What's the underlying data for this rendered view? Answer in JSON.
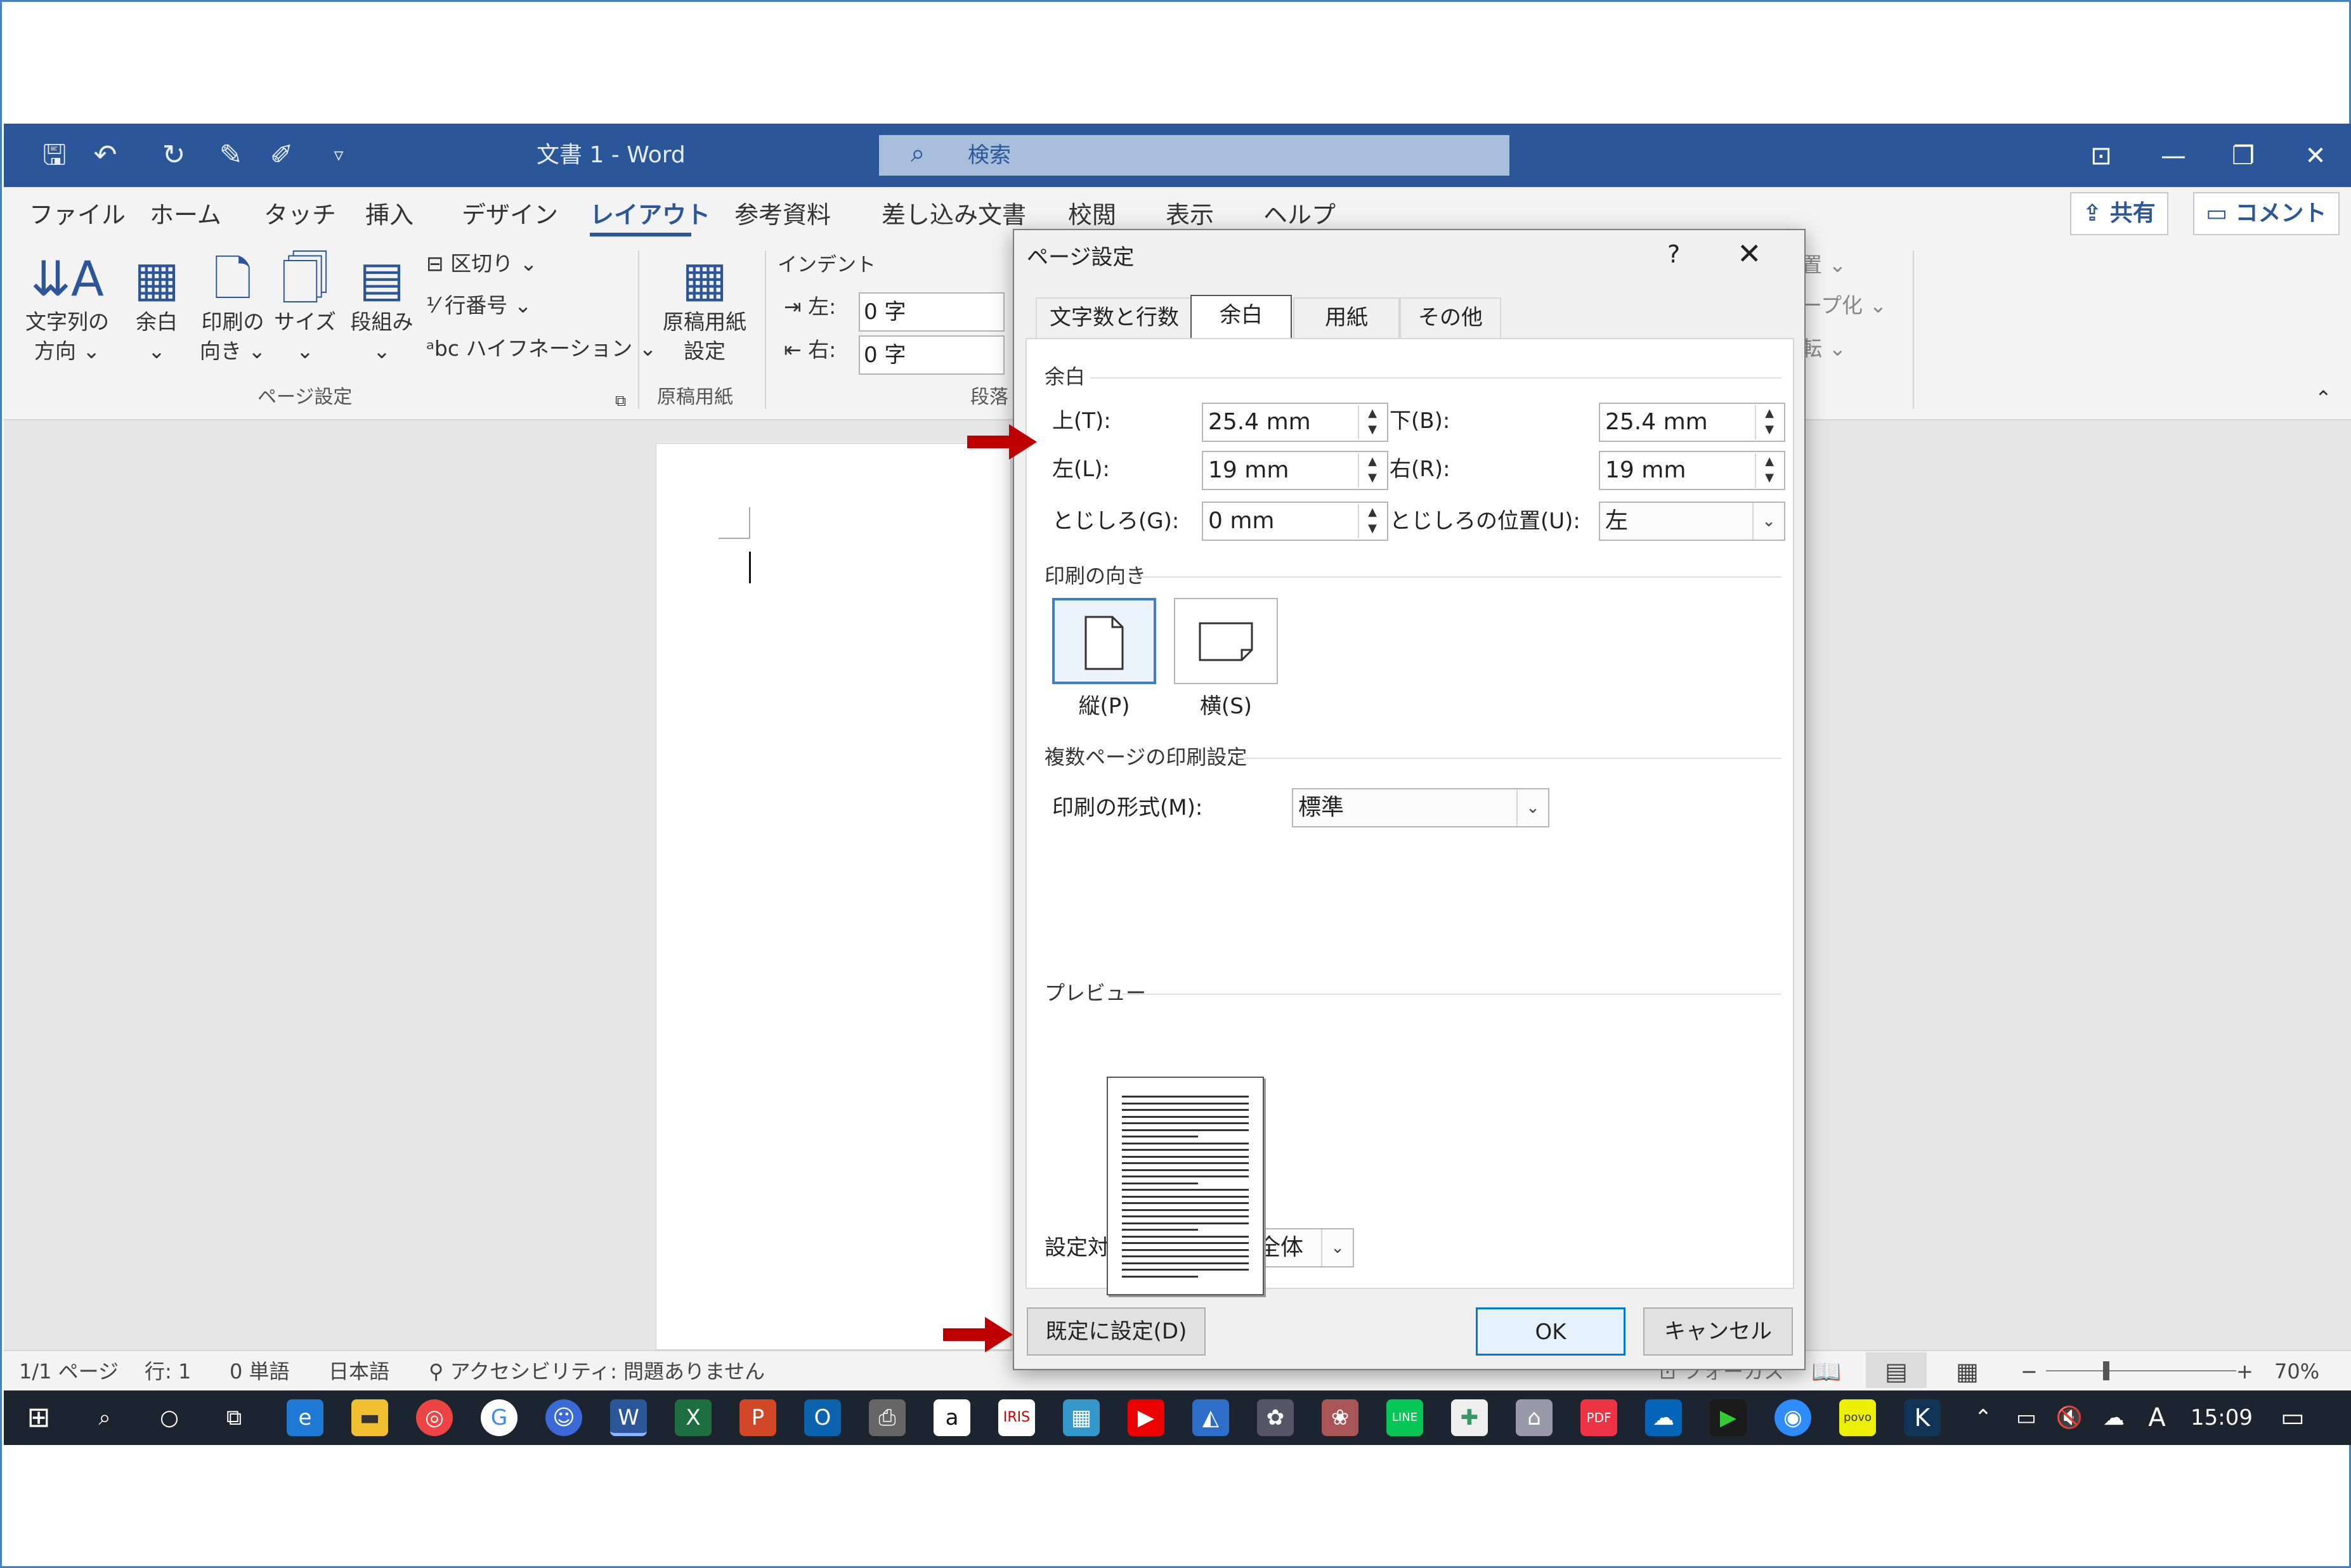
{
  "app": {
    "doc_title": "文書 1  -  Word",
    "search_placeholder": "検索"
  },
  "ribbon": {
    "tabs": [
      "ファイル",
      "ホーム",
      "タッチ",
      "挿入",
      "デザイン",
      "レイアウト",
      "参考資料",
      "差し込み文書",
      "校閲",
      "表示",
      "ヘルプ"
    ],
    "active_tab": "レイアウト",
    "share": "共有",
    "comment": "コメント",
    "buttons": {
      "text_direction": [
        "文字列の",
        "方向 ⌄"
      ],
      "margins": [
        "余白",
        "⌄"
      ],
      "orientation": [
        "印刷の",
        "向き ⌄"
      ],
      "size": [
        "サイズ",
        "⌄"
      ],
      "columns": [
        "段組み",
        "⌄"
      ],
      "breaks": "区切り ⌄",
      "line_numbers": "行番号 ⌄",
      "hyphenation": "ハイフネーション ⌄",
      "manuscript": [
        "原稿用紙",
        "設定"
      ],
      "indent_title": "インデント",
      "indent_left_label": "左:",
      "indent_left_value": "0 字",
      "indent_right_label": "右:",
      "indent_right_value": "0 字",
      "partial_1": "置 ⌄",
      "partial_2": "ープ化 ⌄",
      "partial_3": "転 ⌄"
    },
    "groups": {
      "page_setup": "ページ設定",
      "manuscript": "原稿用紙",
      "paragraph": "段落"
    }
  },
  "dialog": {
    "title": "ページ設定",
    "help": "?",
    "close": "✕",
    "tabs": [
      "文字数と行数",
      "余白",
      "用紙",
      "その他"
    ],
    "active_tab": "余白",
    "margins_section": "余白",
    "top_label": "上(T):",
    "top_value": "25.4 mm",
    "bottom_label": "下(B):",
    "bottom_value": "25.4 mm",
    "left_label": "左(L):",
    "left_value": "19 mm",
    "right_label": "右(R):",
    "right_value": "19 mm",
    "gutter_label": "とじしろ(G):",
    "gutter_value": "0 mm",
    "gutter_pos_label": "とじしろの位置(U):",
    "gutter_pos_value": "左",
    "orientation_section": "印刷の向き",
    "portrait": "縦(P)",
    "landscape": "横(S)",
    "multipage_section": "複数ページの印刷設定",
    "print_format_label": "印刷の形式(M):",
    "print_format_value": "標準",
    "preview_section": "プレビュー",
    "apply_to_label": "設定対象(Y):",
    "apply_to_value": "文書全体",
    "set_default": "既定に設定(D)",
    "ok": "OK",
    "cancel": "キャンセル"
  },
  "status": {
    "page": "1/1 ページ",
    "line": "行: 1",
    "words": "0 単語",
    "language": "日本語",
    "accessibility": "アクセシビリティ: 問題ありません",
    "focus": "フォーカス",
    "zoom": "70%"
  },
  "taskbar": {
    "time": "15:09",
    "ime": "A"
  }
}
